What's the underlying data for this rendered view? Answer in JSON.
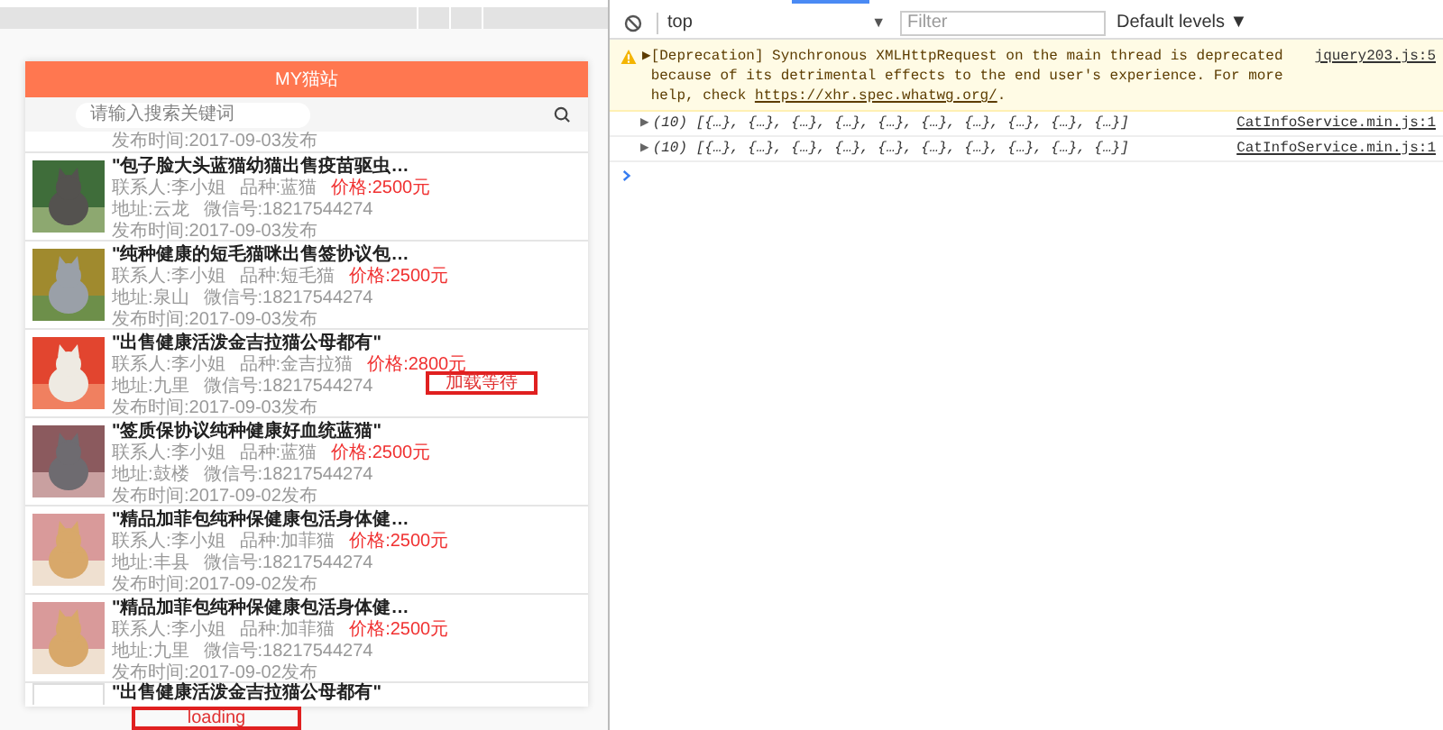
{
  "phone": {
    "header": "MY猫站",
    "search": {
      "placeholder": "请输入搜索关键词"
    },
    "items": [
      {
        "kind": "time_only",
        "time": "发布时间:2017-09-03发布"
      },
      {
        "kind": "full",
        "title": "\"包子脸大头蓝猫幼猫出售疫苗驱虫…",
        "contact": "联系人:李小姐",
        "breed": "品种:蓝猫",
        "price": "价格:2500元",
        "address": "地址:云龙",
        "wechat": "微信号:18217544274",
        "time": "发布时间:2017-09-03发布"
      },
      {
        "kind": "full",
        "title": "\"纯种健康的短毛猫咪出售签协议包…",
        "contact": "联系人:李小姐",
        "breed": "品种:短毛猫",
        "price": "价格:2500元",
        "address": "地址:泉山",
        "wechat": "微信号:18217544274",
        "time": "发布时间:2017-09-03发布"
      },
      {
        "kind": "full",
        "title": "\"出售健康活泼金吉拉猫公母都有\"",
        "contact": "联系人:李小姐",
        "breed": "品种:金吉拉猫",
        "price": "价格:2800元",
        "address": "地址:九里",
        "wechat": "微信号:18217544274",
        "time": "发布时间:2017-09-03发布"
      },
      {
        "kind": "full",
        "title": "\"签质保协议纯种健康好血统蓝猫\"",
        "contact": "联系人:李小姐",
        "breed": "品种:蓝猫",
        "price": "价格:2500元",
        "address": "地址:鼓楼",
        "wechat": "微信号:18217544274",
        "time": "发布时间:2017-09-02发布"
      },
      {
        "kind": "full",
        "title": "\"精品加菲包纯种保健康包活身体健…",
        "contact": "联系人:李小姐",
        "breed": "品种:加菲猫",
        "price": "价格:2500元",
        "address": "地址:丰县",
        "wechat": "微信号:18217544274",
        "time": "发布时间:2017-09-02发布"
      },
      {
        "kind": "full",
        "title": "\"精品加菲包纯种保健康包活身体健…",
        "contact": "联系人:李小姐",
        "breed": "品种:加菲猫",
        "price": "价格:2500元",
        "address": "地址:九里",
        "wechat": "微信号:18217544274",
        "time": "发布时间:2017-09-02发布"
      },
      {
        "kind": "title_only",
        "title": "\"出售健康活泼金吉拉猫公母都有\""
      }
    ],
    "overlays": [
      {
        "text": "加载等待"
      },
      {
        "text": "loading"
      }
    ]
  },
  "devtools": {
    "context": "top",
    "context_arrow": "▼",
    "filter_placeholder": "Filter",
    "levels": "Default levels ▼",
    "messages": [
      {
        "kind": "warning",
        "arrow": "▶",
        "text": "[Deprecation] Synchronous XMLHttpRequest on the main thread is deprecated because of its detrimental effects to the end user's experience. For more help, check ",
        "link": "https://xhr.spec.whatwg.org/",
        "end": ".",
        "source": "jquery203.js:5"
      },
      {
        "kind": "log",
        "arrow": "▶",
        "text": "(10) [{…}, {…}, {…}, {…}, {…}, {…}, {…}, {…}, {…}, {…}]",
        "source": "CatInfoService.min.js:1"
      },
      {
        "kind": "log",
        "arrow": "▶",
        "text": "(10) [{…}, {…}, {…}, {…}, {…}, {…}, {…}, {…}, {…}, {…}]",
        "source": "CatInfoService.min.js:1"
      }
    ]
  }
}
